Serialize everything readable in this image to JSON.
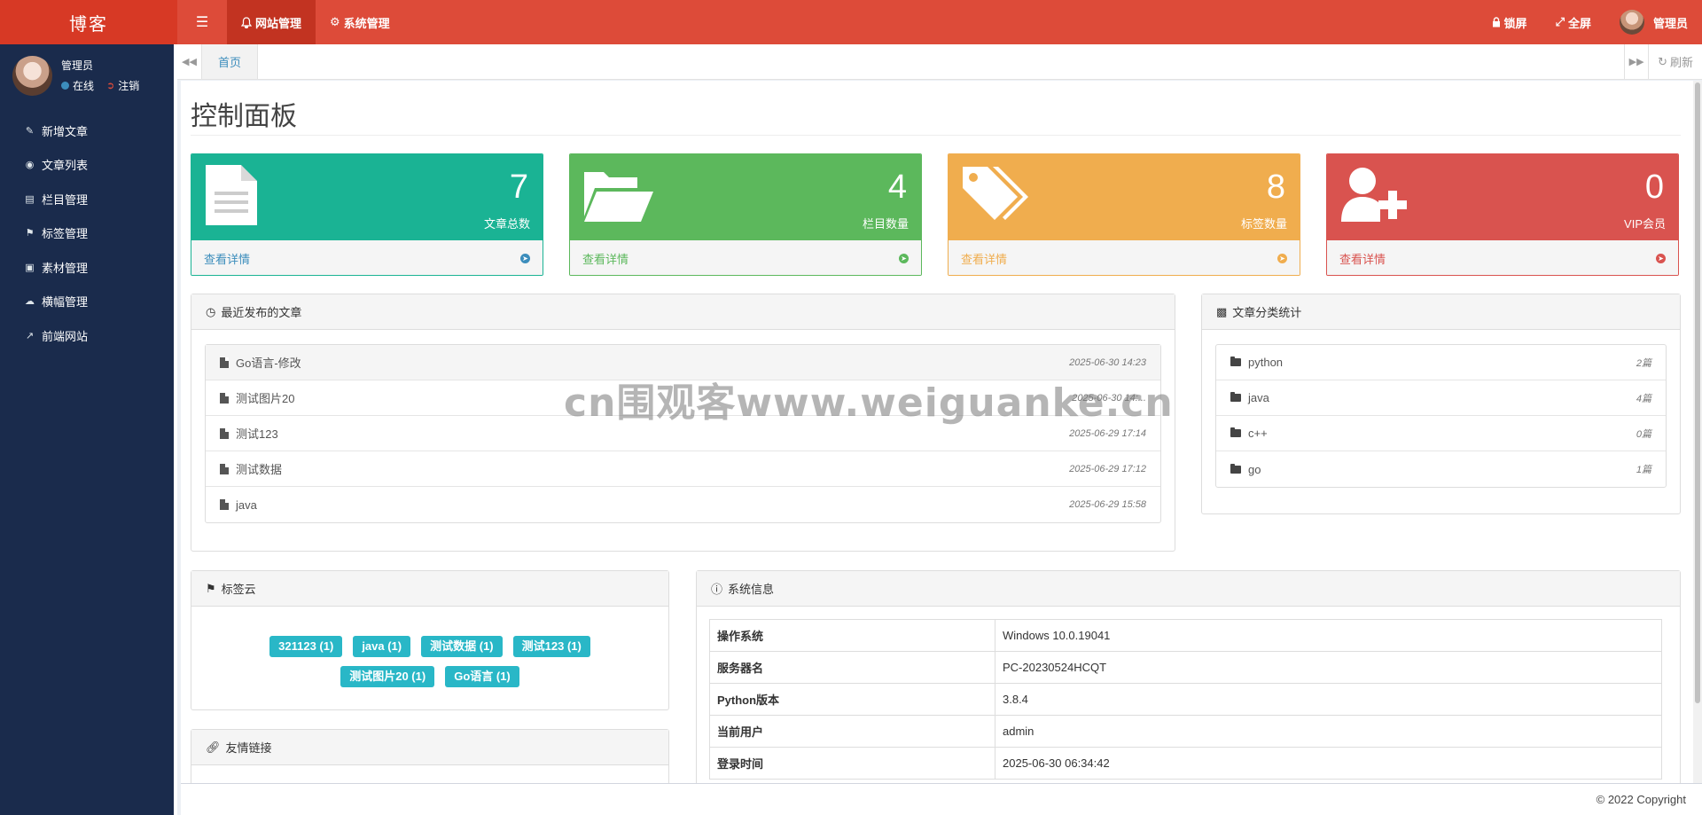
{
  "header": {
    "logo": "博客",
    "nav": [
      {
        "label": "网站管理",
        "icon": "bell-icon",
        "active": true
      },
      {
        "label": "系统管理",
        "icon": "gear-icon",
        "active": false
      }
    ],
    "lock": "锁屏",
    "fullscreen": "全屏",
    "user": "管理员"
  },
  "sidebar": {
    "user_name": "管理员",
    "status_online": "在线",
    "logout": "注销",
    "items": [
      {
        "label": "新增文章",
        "icon": "pencil-icon"
      },
      {
        "label": "文章列表",
        "icon": "dashboard-icon"
      },
      {
        "label": "栏目管理",
        "icon": "columns-icon"
      },
      {
        "label": "标签管理",
        "icon": "flag-icon"
      },
      {
        "label": "素材管理",
        "icon": "image-icon"
      },
      {
        "label": "横幅管理",
        "icon": "cloud-icon"
      },
      {
        "label": "前端网站",
        "icon": "external-link-icon"
      }
    ]
  },
  "tabs": {
    "home": "首页",
    "refresh": "刷新"
  },
  "page": {
    "title": "控制面板"
  },
  "stats": [
    {
      "value": "7",
      "label": "文章总数",
      "link": "查看详情",
      "icon": "document-icon",
      "color": "#1ab394",
      "foot_color": "#3c8dbc",
      "arrow_color": "#3c8dbc"
    },
    {
      "value": "4",
      "label": "栏目数量",
      "link": "查看详情",
      "icon": "folder-open-icon",
      "color": "#5cb85c",
      "foot_color": "#5cb85c",
      "arrow_color": "#5cb85c"
    },
    {
      "value": "8",
      "label": "标签数量",
      "link": "查看详情",
      "icon": "tags-icon",
      "color": "#f0ad4e",
      "foot_color": "#f0ad4e",
      "arrow_color": "#f0ad4e"
    },
    {
      "value": "0",
      "label": "VIP会员",
      "link": "查看详情",
      "icon": "user-plus-icon",
      "color": "#d9534f",
      "foot_color": "#d9534f",
      "arrow_color": "#d9534f"
    }
  ],
  "recent": {
    "title": "最近发布的文章",
    "items": [
      {
        "title": "Go语言-修改",
        "date": "2025-06-30 14:23"
      },
      {
        "title": "测试图片20",
        "date": "2025-06-30 14:..."
      },
      {
        "title": "测试123",
        "date": "2025-06-29 17:14"
      },
      {
        "title": "测试数据",
        "date": "2025-06-29 17:12"
      },
      {
        "title": "java",
        "date": "2025-06-29 15:58"
      }
    ]
  },
  "categories": {
    "title": "文章分类统计",
    "items": [
      {
        "name": "python",
        "count": "2篇"
      },
      {
        "name": "java",
        "count": "4篇"
      },
      {
        "name": "c++",
        "count": "0篇"
      },
      {
        "name": "go",
        "count": "1篇"
      }
    ]
  },
  "tagcloud": {
    "title": "标签云",
    "tags": [
      "321123 (1)",
      "java (1)",
      "测试数据 (1)",
      "测试123 (1)",
      "测试图片20 (1)",
      "Go语言 (1)"
    ]
  },
  "links": {
    "title": "友情链接"
  },
  "sysinfo": {
    "title": "系统信息",
    "rows": [
      {
        "k": "操作系统",
        "v": "Windows 10.0.19041"
      },
      {
        "k": "服务器名",
        "v": "PC-20230524HCQT"
      },
      {
        "k": "Python版本",
        "v": "3.8.4"
      },
      {
        "k": "当前用户",
        "v": "admin"
      },
      {
        "k": "登录时间",
        "v": "2025-06-30 06:34:42"
      }
    ]
  },
  "footer": {
    "copyright": "© 2022 Copyright"
  },
  "watermark": "cn围观客www.weiguanke.cn"
}
